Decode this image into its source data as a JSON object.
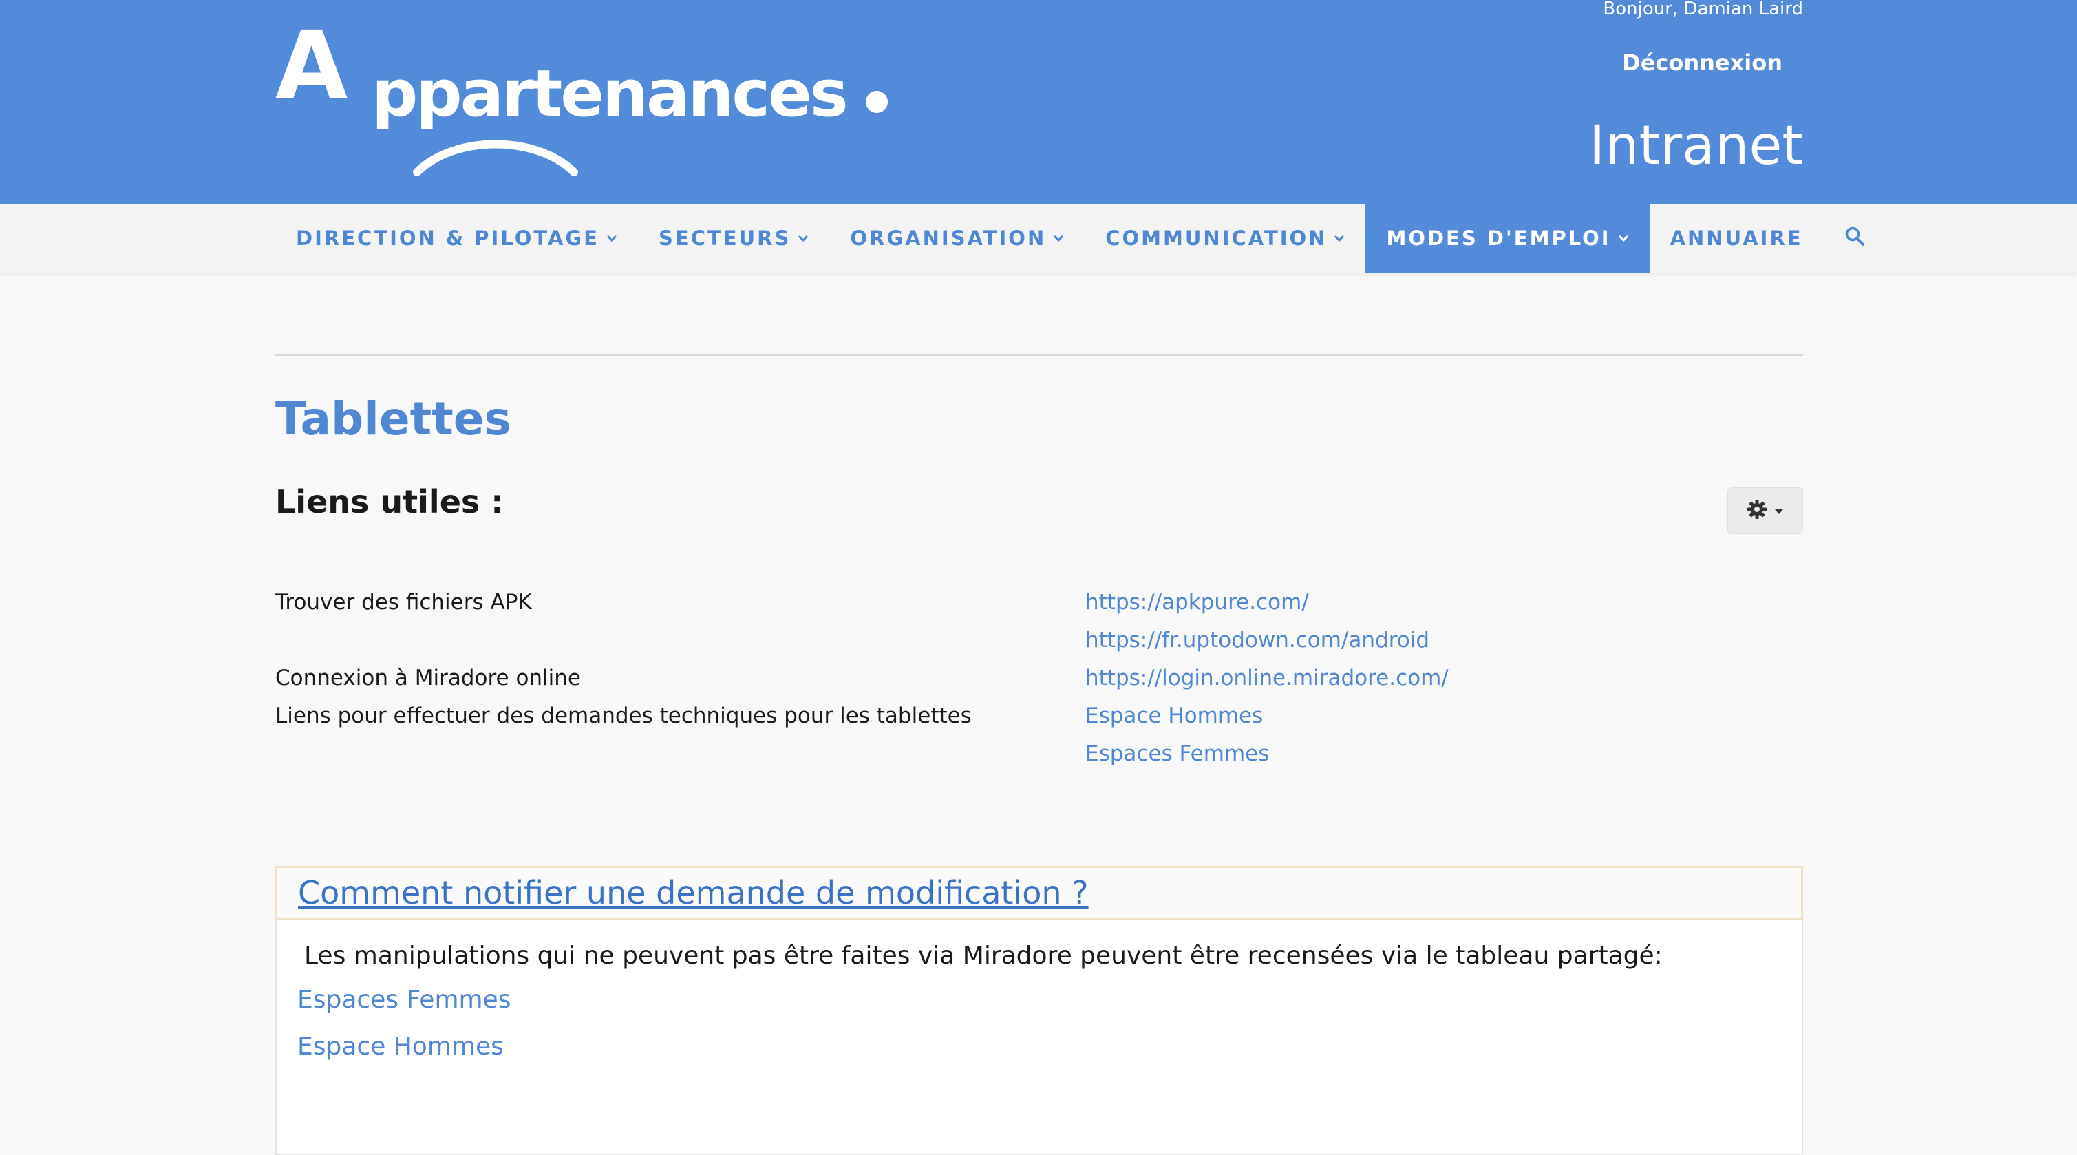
{
  "header": {
    "logo": {
      "initial": "A",
      "word": "ppartenances"
    },
    "greeting": "Bonjour, Damian Laird",
    "logout_label": "Déconnexion",
    "site_name": "Intranet"
  },
  "nav": {
    "items": [
      {
        "label": "DIRECTION & PILOTAGE",
        "has_dropdown": true,
        "active": false
      },
      {
        "label": "SECTEURS",
        "has_dropdown": true,
        "active": false
      },
      {
        "label": "ORGANISATION",
        "has_dropdown": true,
        "active": false
      },
      {
        "label": "COMMUNICATION",
        "has_dropdown": true,
        "active": false
      },
      {
        "label": "MODES D'EMPLOI",
        "has_dropdown": true,
        "active": true
      },
      {
        "label": "ANNUAIRE",
        "has_dropdown": false,
        "active": false
      }
    ],
    "search_icon": "search-icon"
  },
  "page": {
    "title": "Tablettes",
    "section_title": "Liens utiles :",
    "gear_icon": "gear-icon",
    "links_left": [
      "Trouver des fichiers APK",
      "",
      "Connexion à Miradore online",
      "Liens pour effectuer des demandes techniques pour les tablettes"
    ],
    "links_right": [
      "https://apkpure.com/",
      "https://fr.uptodown.com/android",
      "https://login.online.miradore.com/",
      "Espace Hommes",
      "Espaces Femmes"
    ]
  },
  "panel": {
    "title": "Comment notifier une demande de modification ?",
    "text": "Les manipulations qui ne peuvent pas être faites via Miradore peuvent être recensées via le tableau partagé:",
    "links": [
      "Espaces Femmes",
      "Espace Hommes"
    ]
  },
  "colors": {
    "brand_blue": "#528bda",
    "link_blue": "#4f87d3",
    "page_bg": "#f8f8f8",
    "nav_bg": "#f3f3f3"
  }
}
